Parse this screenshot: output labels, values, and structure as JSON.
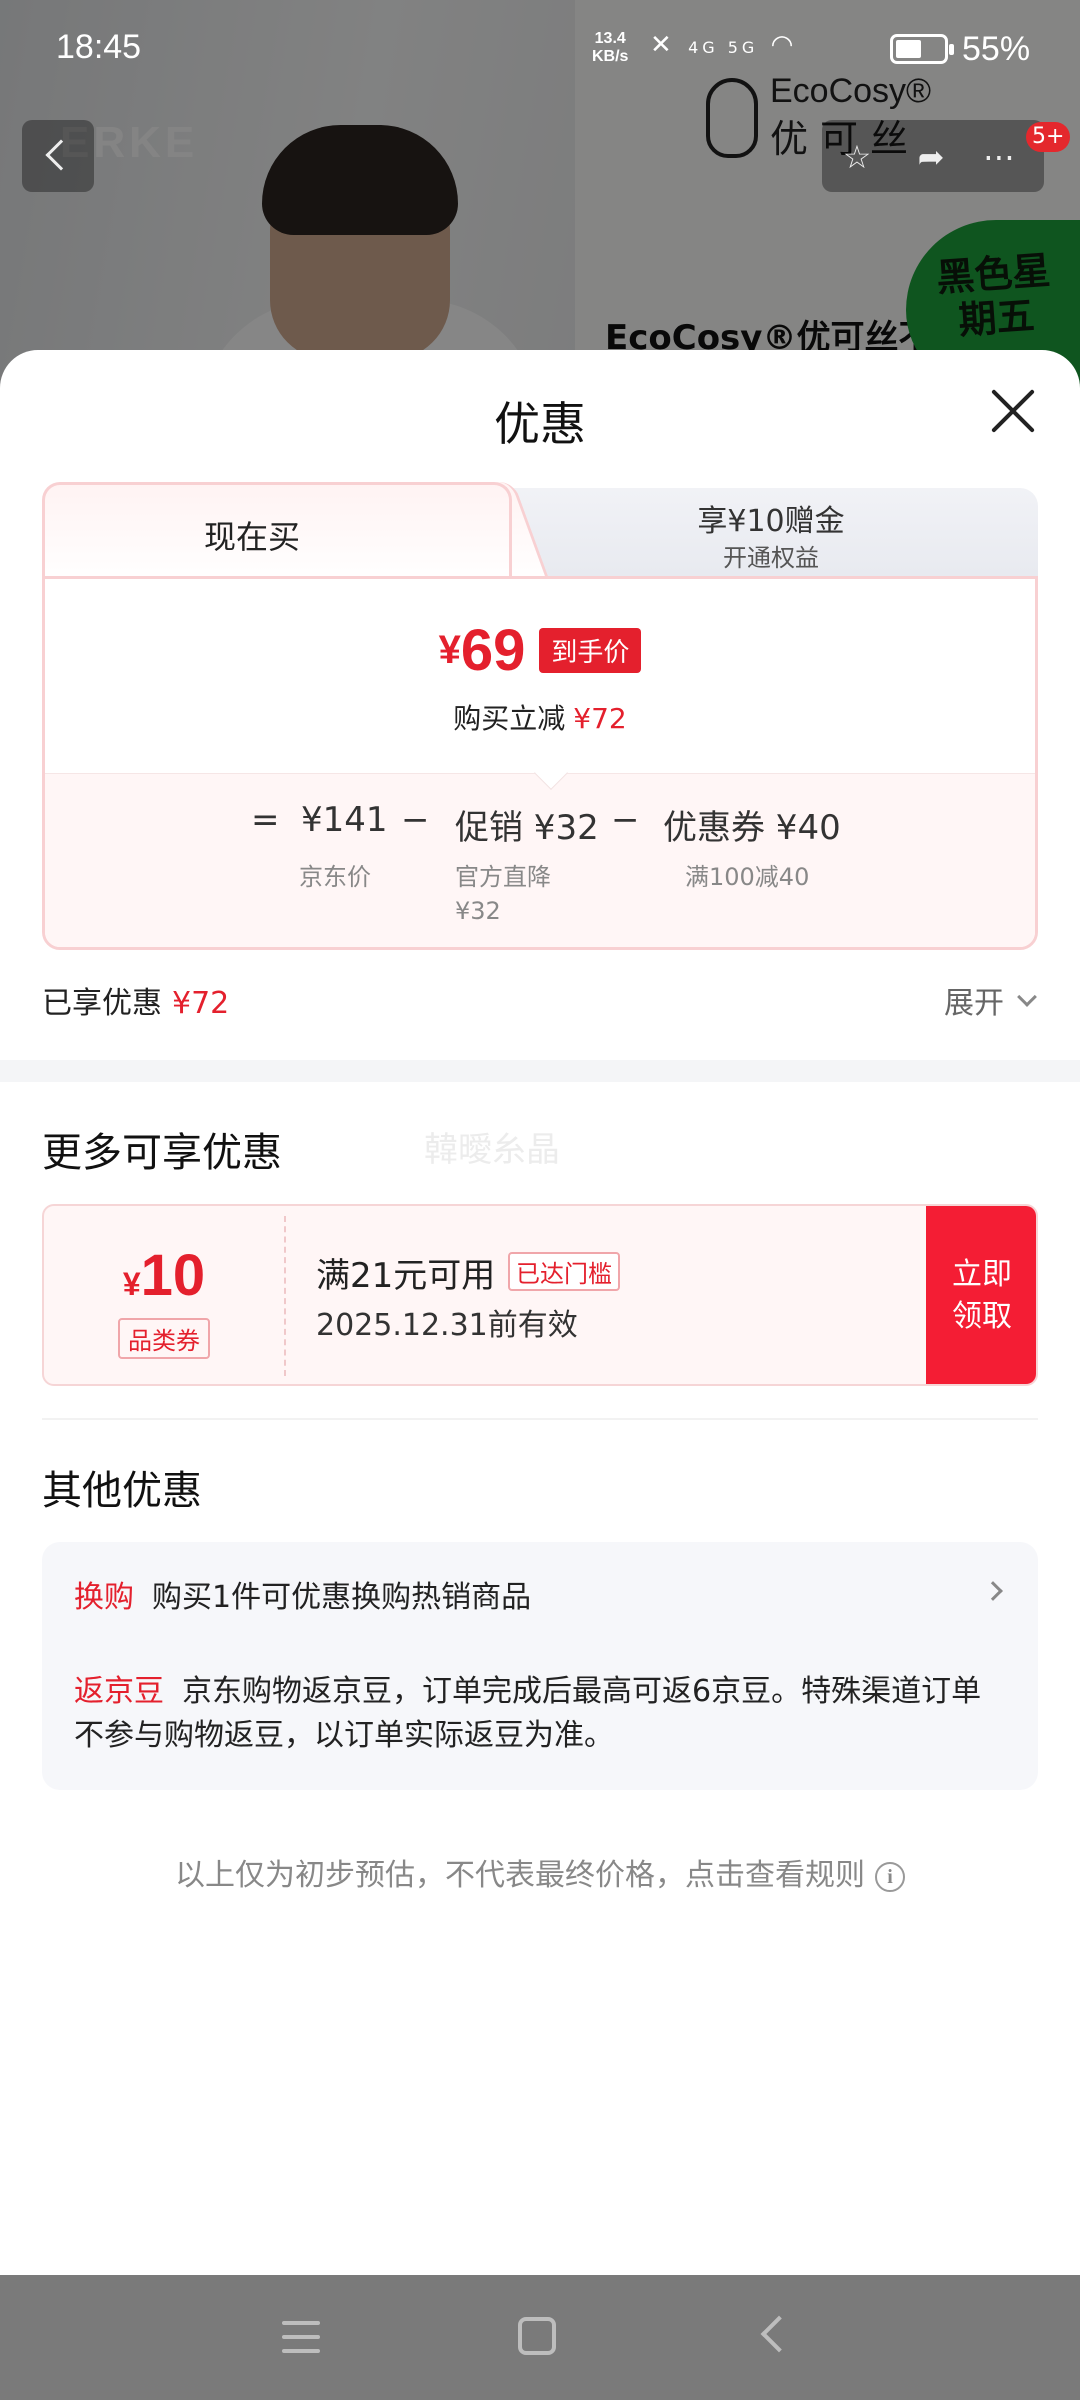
{
  "status_bar": {
    "time": "18:45",
    "net_speed_value": "13.4",
    "net_speed_unit": "KB/s",
    "signal": "4G 5G",
    "battery": "55%"
  },
  "background_page": {
    "brand_logo": "ERKE",
    "brand_en": "EcoCosy®",
    "brand_cn": "优可丝",
    "headline": "EcoCosy®优可丝不",
    "promo_badge": "黑色星期五",
    "cart_count": "5+"
  },
  "sheet": {
    "title": "优惠",
    "tabs": {
      "active_label": "现在买",
      "inactive_title": "享¥10赠金",
      "inactive_sub": "开通权益"
    },
    "price": {
      "currency": "¥",
      "value": "69",
      "tag": "到手价",
      "reduce_label": "购买立减",
      "reduce_amount": "¥72"
    },
    "breakdown": {
      "equals": "=",
      "jd_price": "¥141",
      "jd_price_label": "京东价",
      "minus1": "−",
      "promo": "促销 ¥32",
      "promo_label_line1": "官方直降",
      "promo_label_line2": "¥32",
      "minus2": "−",
      "coupon": "优惠券 ¥40",
      "coupon_label": "满100减40"
    },
    "enjoyed_label": "已享优惠",
    "enjoyed_amount": "¥72",
    "expand_label": "展开",
    "more_title": "更多可享优惠",
    "watermark": "韓曖糸晶",
    "coupon_card": {
      "currency": "¥",
      "amount": "10",
      "type": "品类券",
      "condition": "满21元可用",
      "flag": "已达门槛",
      "valid": "2025.12.31前有效",
      "button_line1": "立即",
      "button_line2": "领取"
    },
    "other_title": "其他优惠",
    "other": {
      "exchange_tag": "换购",
      "exchange_text": "购买1件可优惠换购热销商品",
      "beans_tag": "返京豆",
      "beans_text": "京东购物返京豆，订单完成后最高可返6京豆。特殊渠道订单不参与购物返豆，以订单实际返豆为准。"
    },
    "rules_text": "以上仅为初步预估，不代表最终价格，点击查看规则",
    "info_glyph": "i"
  },
  "colors": {
    "accent_red": "#e4202d",
    "button_red": "#f41d34"
  }
}
